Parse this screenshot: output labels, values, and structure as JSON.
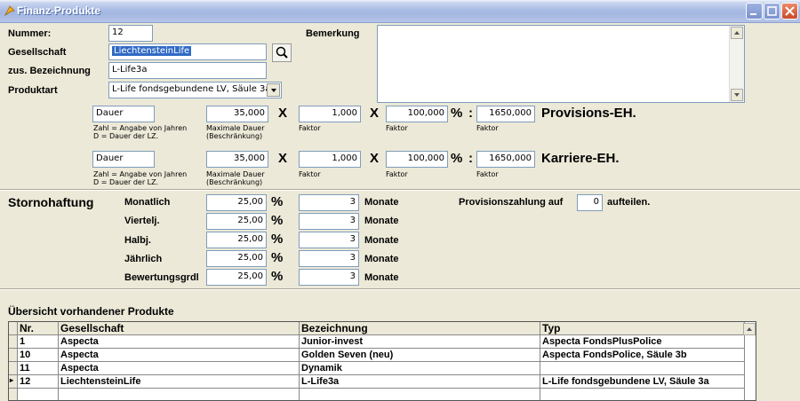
{
  "window": {
    "title": "Finanz-Produkte"
  },
  "form": {
    "nummer_label": "Nummer:",
    "nummer_value": "12",
    "gesellschaft_label": "Gesellschaft",
    "gesellschaft_value": "LiechtensteinLife",
    "zus_bez_label": "zus. Bezeichnung",
    "zus_bez_value": "L-Life3a",
    "produktart_label": "Produktart",
    "produktart_value": "L-Life fondsgebundene LV, Säule 3a",
    "bemerkung_label": "Bemerkung",
    "bemerkung_value": ""
  },
  "provision": {
    "dauer": "Dauer",
    "max": "35,000",
    "faktor1": "1,000",
    "faktor2": "100,000",
    "result": "1650,000",
    "x_sign": "X",
    "percent_sign": "%",
    "colon": ":",
    "title": "Provisions-EH.",
    "help1": "Zahl = Angabe von Jahren",
    "help2": "D = Dauer der LZ.",
    "max_label1": "Maximale Dauer",
    "max_label2": "(Beschränkung)",
    "faktor_label": "Faktor"
  },
  "karriere": {
    "dauer": "Dauer",
    "max": "35,000",
    "faktor1": "1,000",
    "faktor2": "100,000",
    "result": "1650,000",
    "title": "Karriere-EH."
  },
  "storno": {
    "title": "Stornohaftung",
    "rows": [
      {
        "label": "Monatlich",
        "percent": "25,00",
        "months": "3"
      },
      {
        "label": "Viertelj.",
        "percent": "25,00",
        "months": "3"
      },
      {
        "label": "Halbj.",
        "percent": "25,00",
        "months": "3"
      },
      {
        "label": "Jährlich",
        "percent": "25,00",
        "months": "3"
      },
      {
        "label": "Bewertungsgrdl",
        "percent": "25,00",
        "months": "3"
      }
    ],
    "percent_sign": "%",
    "months_label": "Monate",
    "provision_prefix": "Provisionszahlung auf",
    "provision_value": "0",
    "provision_suffix": "aufteilen."
  },
  "overview": {
    "title": "Übersicht vorhandener Produkte",
    "columns": [
      "Nr.",
      "Gesellschaft",
      "Bezeichnung",
      "Typ"
    ],
    "rows": [
      {
        "nr": "1",
        "gesellschaft": "Aspecta",
        "bezeichnung": "Junior-invest",
        "typ": "Aspecta FondsPlusPolice"
      },
      {
        "nr": "10",
        "gesellschaft": "Aspecta",
        "bezeichnung": "Golden Seven (neu)",
        "typ": "Aspecta FondsPolice, Säule 3b"
      },
      {
        "nr": "11",
        "gesellschaft": "Aspecta",
        "bezeichnung": "Dynamik",
        "typ": ""
      },
      {
        "nr": "12",
        "gesellschaft": "LiechtensteinLife",
        "bezeichnung": "L-Life3a",
        "typ": "L-Life fondsgebundene LV, Säule 3a"
      }
    ],
    "current_row_marker": "▸"
  }
}
